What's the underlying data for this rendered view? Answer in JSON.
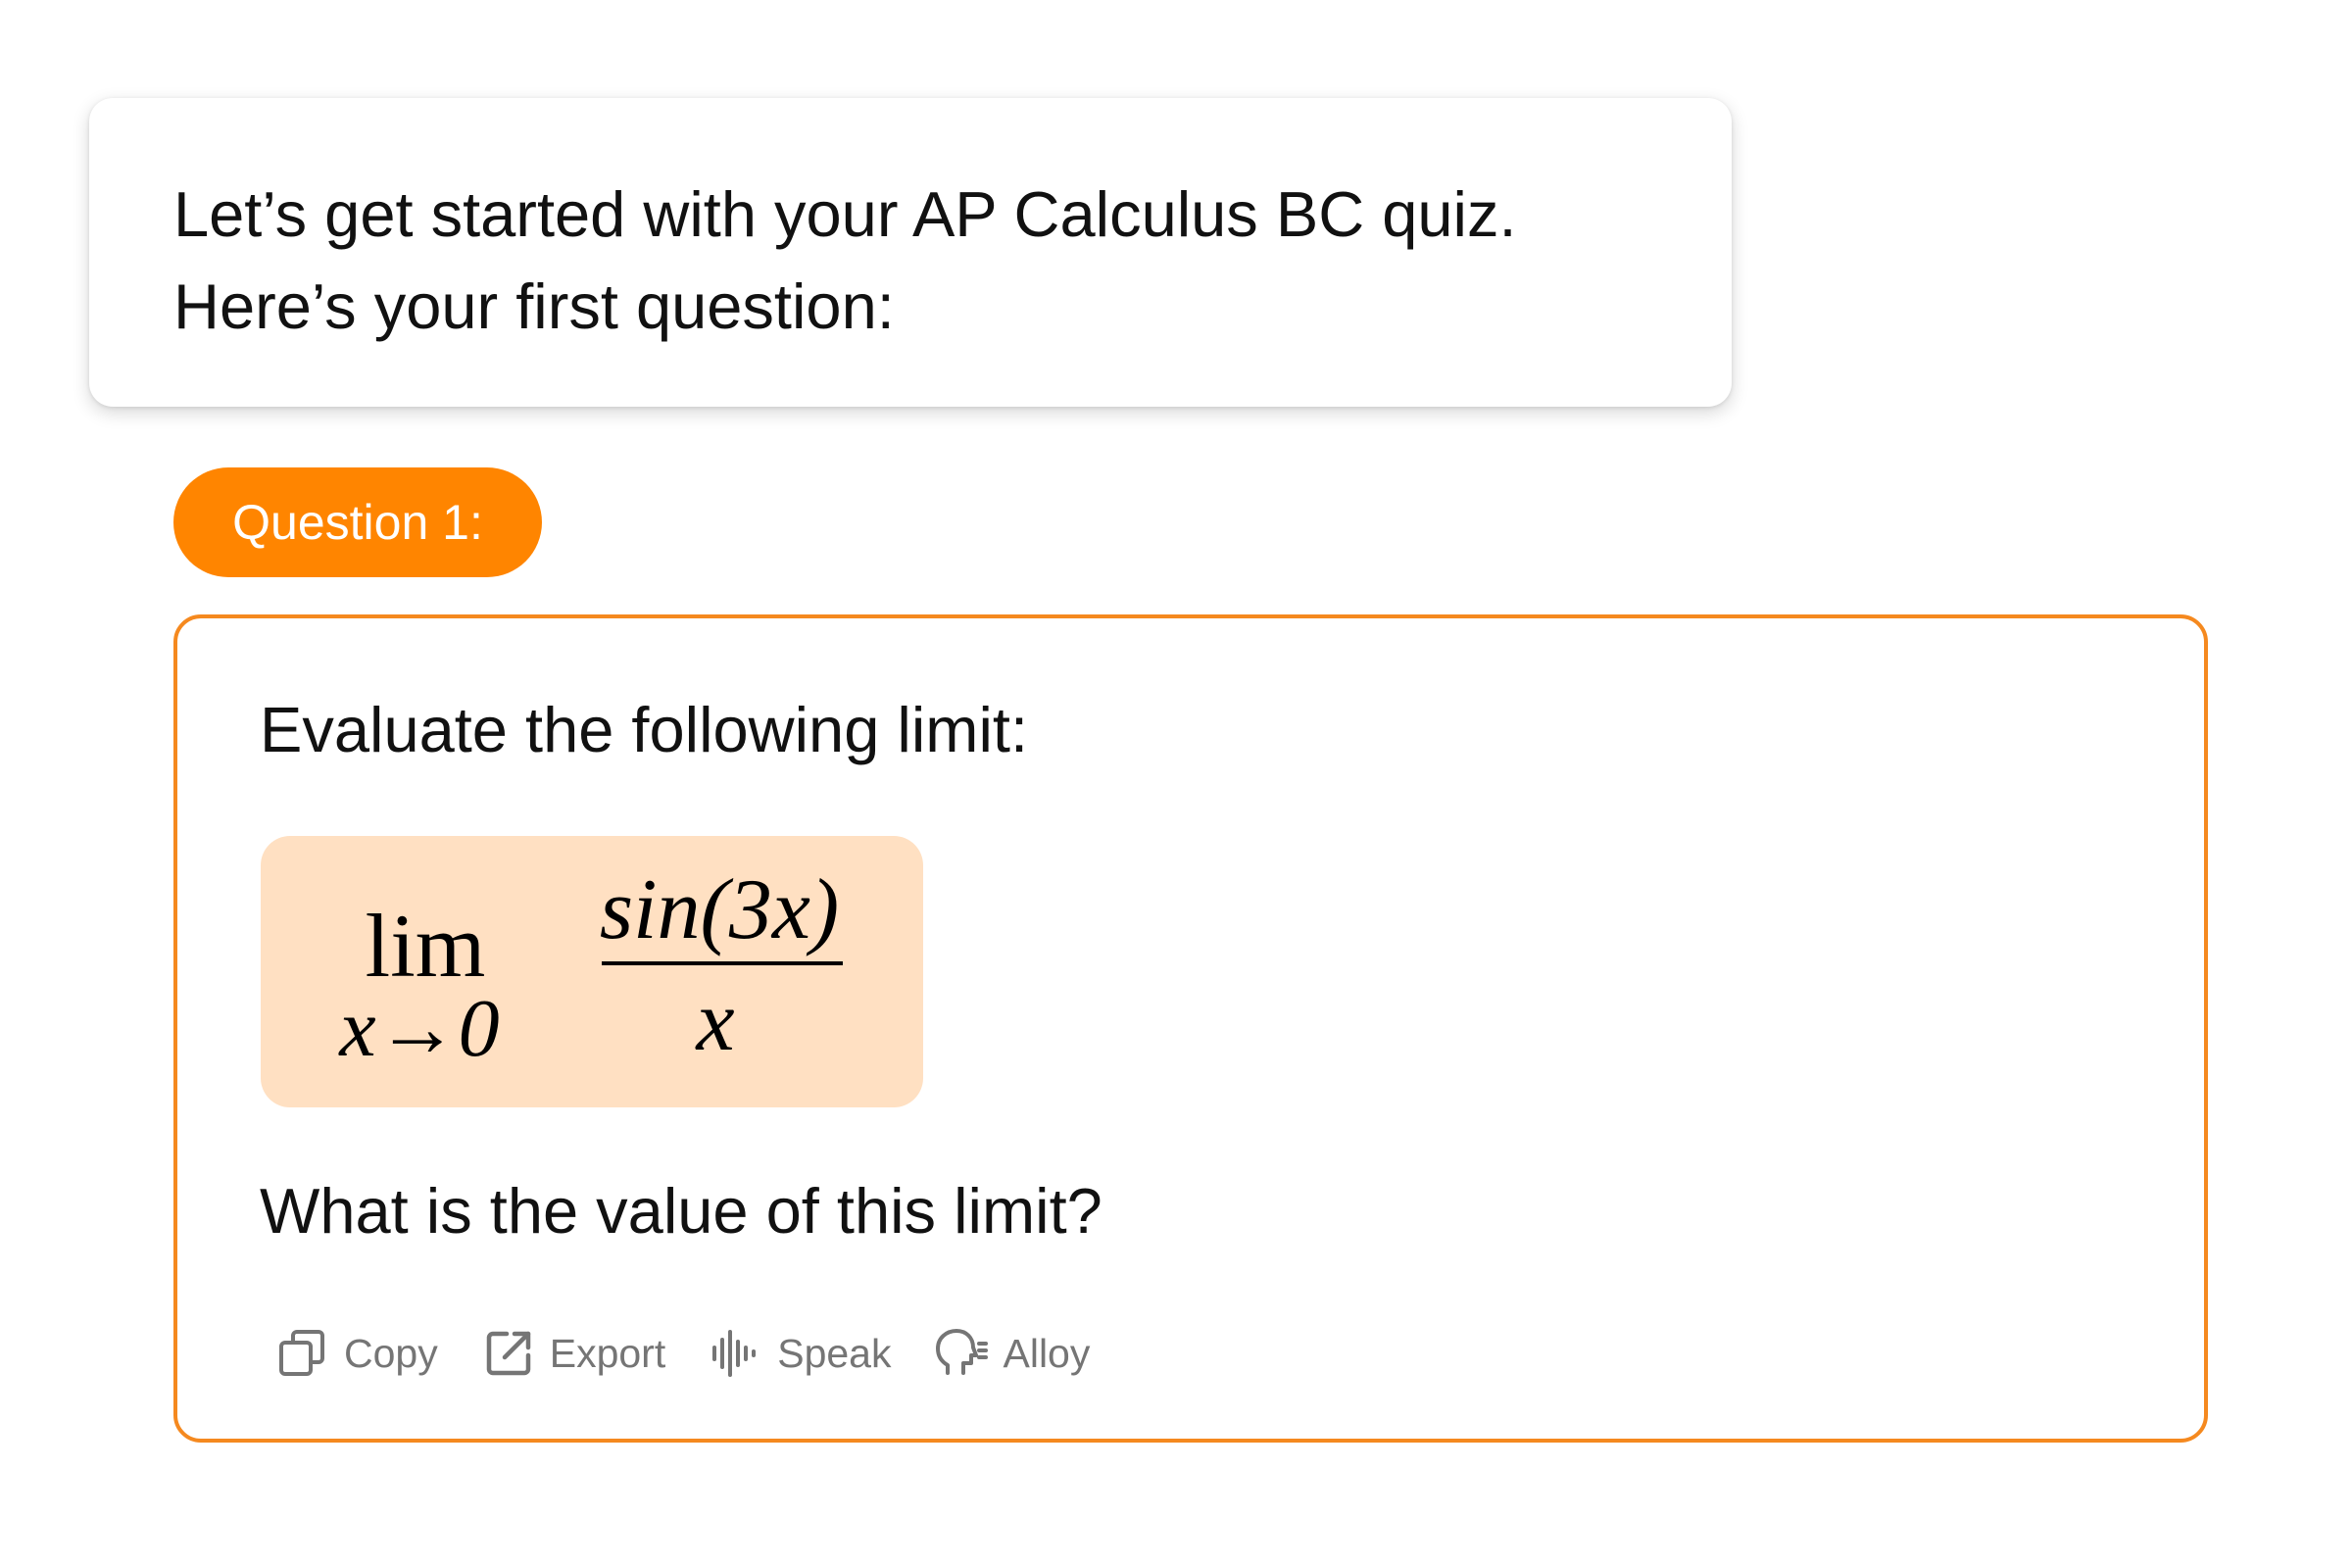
{
  "intro": {
    "line1": "Let’s get started with your AP Calculus BC quiz.",
    "line2": "Here’s your first question:"
  },
  "question_badge": "Question 1:",
  "question": {
    "prompt": "Evaluate the following limit:",
    "formula": {
      "lim": "lim",
      "subscript": "x→0",
      "numerator": "sin(3x)",
      "denominator": "x"
    },
    "ask": "What is the value of this limit?"
  },
  "actions": [
    {
      "label": "Copy",
      "icon": "copy-icon"
    },
    {
      "label": "Export",
      "icon": "export-icon"
    },
    {
      "label": "Speak",
      "icon": "speak-icon"
    },
    {
      "label": "Alloy",
      "icon": "voice-head-icon"
    }
  ],
  "colors": {
    "accent": "#ff8500",
    "card_border": "#f5891f",
    "formula_background": "#ffe0c2",
    "action_text": "#757575"
  }
}
